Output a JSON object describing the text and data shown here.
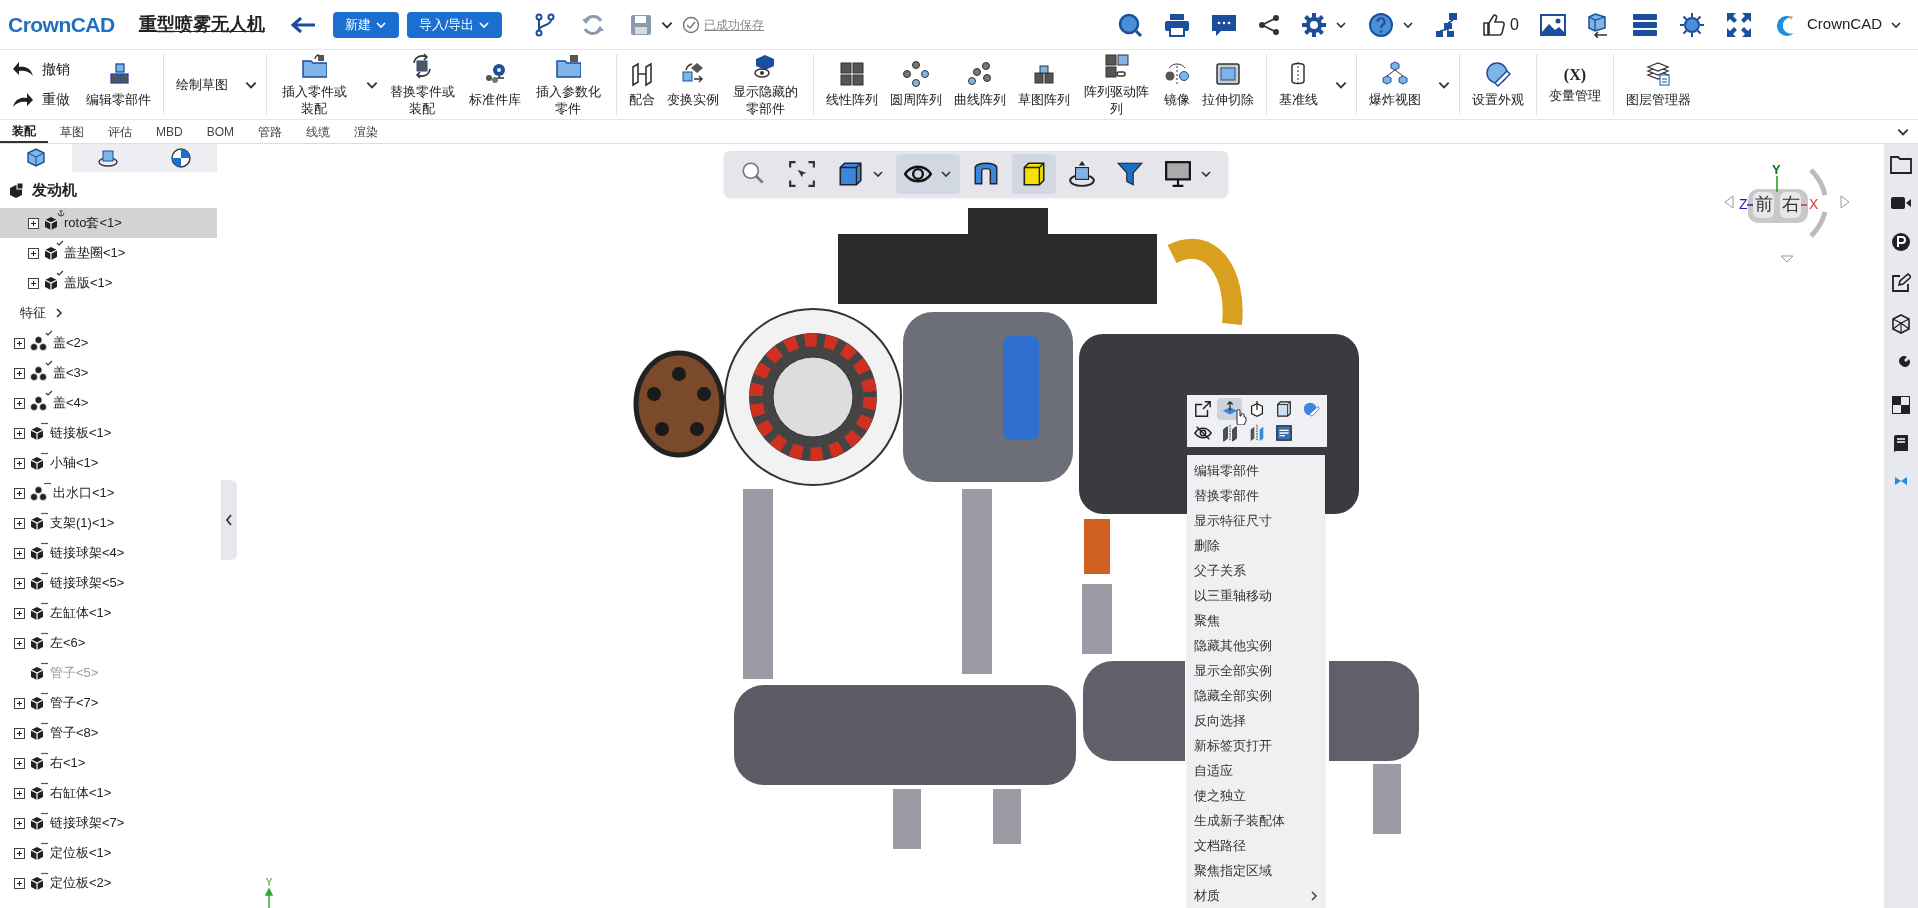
{
  "header": {
    "logo": "CrownCAD",
    "title": "重型喷雾无人机",
    "buttons": [
      {
        "label": "新建",
        "dropdown": true
      },
      {
        "label": "导入/导出",
        "dropdown": true
      }
    ],
    "save_status": "已成功保存",
    "like_count": "0",
    "user": "CrownCAD"
  },
  "ribbon": {
    "groups": [
      [
        {
          "label": "撤销",
          "kind": "small"
        },
        {
          "label": "重做",
          "kind": "small"
        },
        {
          "label": "编辑零部件",
          "kind": "large",
          "dropdown": false
        }
      ],
      [
        {
          "label": "绘制草图",
          "kind": "text",
          "dropdown": true
        }
      ],
      [
        {
          "label": "插入零件或装配",
          "kind": "large",
          "dropdown": true
        },
        {
          "label": "替换零件或装配",
          "kind": "large",
          "dropdown": false
        },
        {
          "label": "标准件库",
          "kind": "large",
          "dropdown": false
        },
        {
          "label": "插入参数化零件",
          "kind": "large",
          "dropdown": false
        }
      ],
      [
        {
          "label": "配合",
          "kind": "large",
          "dropdown": false
        },
        {
          "label": "变换实例",
          "kind": "large",
          "dropdown": false
        },
        {
          "label": "显示隐藏的零部件",
          "kind": "large",
          "dropdown": false
        }
      ],
      [
        {
          "label": "线性阵列",
          "kind": "large",
          "dropdown": false
        },
        {
          "label": "圆周阵列",
          "kind": "large",
          "dropdown": false
        },
        {
          "label": "曲线阵列",
          "kind": "large",
          "dropdown": false
        },
        {
          "label": "草图阵列",
          "kind": "large",
          "dropdown": false
        },
        {
          "label": "阵列驱动阵列",
          "kind": "large",
          "dropdown": false
        },
        {
          "label": "镜像",
          "kind": "large",
          "dropdown": false
        },
        {
          "label": "拉伸切除",
          "kind": "large",
          "dropdown": false
        }
      ],
      [
        {
          "label": "基准线",
          "kind": "large",
          "dropdown": true
        }
      ],
      [
        {
          "label": "爆炸视图",
          "kind": "large",
          "dropdown": true
        }
      ],
      [
        {
          "label": "设置外观",
          "kind": "large",
          "dropdown": false
        }
      ],
      [
        {
          "label": "变量管理",
          "kind": "symbol",
          "symbol": "(X)",
          "dropdown": false
        }
      ],
      [
        {
          "label": "图层管理器",
          "kind": "large",
          "dropdown": false
        }
      ]
    ]
  },
  "tabs": [
    {
      "label": "装配",
      "selected": true
    },
    {
      "label": "草图",
      "selected": false
    },
    {
      "label": "评估",
      "selected": false
    },
    {
      "label": "MBD",
      "selected": false
    },
    {
      "label": "BOM",
      "selected": false
    },
    {
      "label": "管路",
      "selected": false
    },
    {
      "label": "线缆",
      "selected": false
    },
    {
      "label": "渲染",
      "selected": false
    }
  ],
  "model_tree": {
    "panel_tabs": [
      {
        "selected": true
      },
      {
        "selected": false
      },
      {
        "selected": false
      }
    ],
    "root": "发动机",
    "children": [
      {
        "label": "roto套<1>",
        "kind": "part",
        "fixed": true,
        "mated": false,
        "expandable": true,
        "selected": true,
        "dimmed": false
      },
      {
        "label": "盖垫圈<1>",
        "kind": "part",
        "fixed": false,
        "mated": true,
        "expandable": true,
        "selected": false,
        "dimmed": false
      },
      {
        "label": "盖版<1>",
        "kind": "part",
        "fixed": false,
        "mated": true,
        "expandable": true,
        "selected": false,
        "dimmed": false
      }
    ],
    "features_label": "特征",
    "items": [
      {
        "label": "盖<2>",
        "kind": "assembly",
        "fixed": false,
        "mated": true,
        "expandable": true,
        "selected": false,
        "dimmed": false
      },
      {
        "label": "盖<3>",
        "kind": "assembly",
        "fixed": false,
        "mated": true,
        "expandable": true,
        "selected": false,
        "dimmed": false
      },
      {
        "label": "盖<4>",
        "kind": "assembly",
        "fixed": false,
        "mated": true,
        "expandable": true,
        "selected": false,
        "dimmed": false
      },
      {
        "label": "链接板<1>",
        "kind": "part",
        "fixed": false,
        "mated": false,
        "expandable": true,
        "selected": false,
        "dimmed": false
      },
      {
        "label": "小轴<1>",
        "kind": "part",
        "fixed": false,
        "mated": false,
        "expandable": true,
        "selected": false,
        "dimmed": false
      },
      {
        "label": "出水口<1>",
        "kind": "assembly",
        "fixed": false,
        "mated": false,
        "expandable": true,
        "selected": false,
        "dimmed": false
      },
      {
        "label": "支架(1)<1>",
        "kind": "part",
        "fixed": false,
        "mated": false,
        "expandable": true,
        "selected": false,
        "dimmed": false
      },
      {
        "label": "链接球架<4>",
        "kind": "part",
        "fixed": false,
        "mated": false,
        "expandable": true,
        "selected": false,
        "dimmed": false
      },
      {
        "label": "链接球架<5>",
        "kind": "part",
        "fixed": false,
        "mated": false,
        "expandable": true,
        "selected": false,
        "dimmed": false
      },
      {
        "label": "左缸体<1>",
        "kind": "part",
        "fixed": false,
        "mated": false,
        "expandable": true,
        "selected": false,
        "dimmed": false
      },
      {
        "label": "左<6>",
        "kind": "part",
        "fixed": false,
        "mated": false,
        "expandable": true,
        "selected": false,
        "dimmed": false
      },
      {
        "label": "管子<5>",
        "kind": "part",
        "fixed": false,
        "mated": false,
        "expandable": false,
        "selected": false,
        "dimmed": true
      },
      {
        "label": "管子<7>",
        "kind": "part",
        "fixed": false,
        "mated": false,
        "expandable": true,
        "selected": false,
        "dimmed": false
      },
      {
        "label": "管子<8>",
        "kind": "part",
        "fixed": false,
        "mated": false,
        "expandable": true,
        "selected": false,
        "dimmed": false
      },
      {
        "label": "右<1>",
        "kind": "part",
        "fixed": false,
        "mated": false,
        "expandable": true,
        "selected": false,
        "dimmed": false
      },
      {
        "label": "右缸体<1>",
        "kind": "part",
        "fixed": false,
        "mated": false,
        "expandable": true,
        "selected": false,
        "dimmed": false
      },
      {
        "label": "链接球架<7>",
        "kind": "part",
        "fixed": false,
        "mated": false,
        "expandable": true,
        "selected": false,
        "dimmed": false
      },
      {
        "label": "定位板<1>",
        "kind": "part",
        "fixed": false,
        "mated": false,
        "expandable": true,
        "selected": false,
        "dimmed": false
      },
      {
        "label": "定位板<2>",
        "kind": "part",
        "fixed": false,
        "mated": false,
        "expandable": true,
        "selected": false,
        "dimmed": false
      }
    ]
  },
  "view_toolbar": [
    {
      "dropdown": false,
      "pressed": false
    },
    {
      "dropdown": false,
      "pressed": false
    },
    {
      "dropdown": true,
      "pressed": false
    },
    {
      "dropdown": true,
      "pressed": true
    },
    {
      "dropdown": false,
      "pressed": false
    },
    {
      "dropdown": false,
      "pressed": true
    },
    {
      "dropdown": false,
      "pressed": false
    },
    {
      "dropdown": false,
      "pressed": false
    },
    {
      "dropdown": true,
      "pressed": false
    }
  ],
  "context_menu": {
    "tools": [
      {
        "highlighted": false
      },
      {
        "highlighted": true
      },
      {
        "highlighted": false
      },
      {
        "highlighted": false
      },
      {
        "highlighted": false
      },
      {
        "highlighted": false
      },
      {
        "highlighted": false
      },
      {
        "highlighted": false
      },
      {
        "highlighted": false
      }
    ],
    "items": [
      {
        "label": "编辑零部件",
        "submenu": false
      },
      {
        "label": "替换零部件",
        "submenu": false
      },
      {
        "label": "显示特征尺寸",
        "submenu": false
      },
      {
        "label": "删除",
        "submenu": false
      },
      {
        "label": "父子关系",
        "submenu": false
      },
      {
        "label": "以三重轴移动",
        "submenu": false
      },
      {
        "label": "聚焦",
        "submenu": false
      },
      {
        "label": "隐藏其他实例",
        "submenu": false
      },
      {
        "label": "显示全部实例",
        "submenu": false
      },
      {
        "label": "隐藏全部实例",
        "submenu": false
      },
      {
        "label": "反向选择",
        "submenu": false
      },
      {
        "label": "新标签页打开",
        "submenu": false
      },
      {
        "label": "自适应",
        "submenu": false
      },
      {
        "label": "使之独立",
        "submenu": false
      },
      {
        "label": "生成新子装配体",
        "submenu": false
      },
      {
        "label": "文档路径",
        "submenu": false
      },
      {
        "label": "聚焦指定区域",
        "submenu": false
      },
      {
        "label": "材质",
        "submenu": true
      }
    ]
  },
  "view_cube": {
    "front": "前",
    "right": "右",
    "x": "X",
    "y": "Y",
    "z": "Z"
  },
  "triad": {
    "y": "Y"
  }
}
